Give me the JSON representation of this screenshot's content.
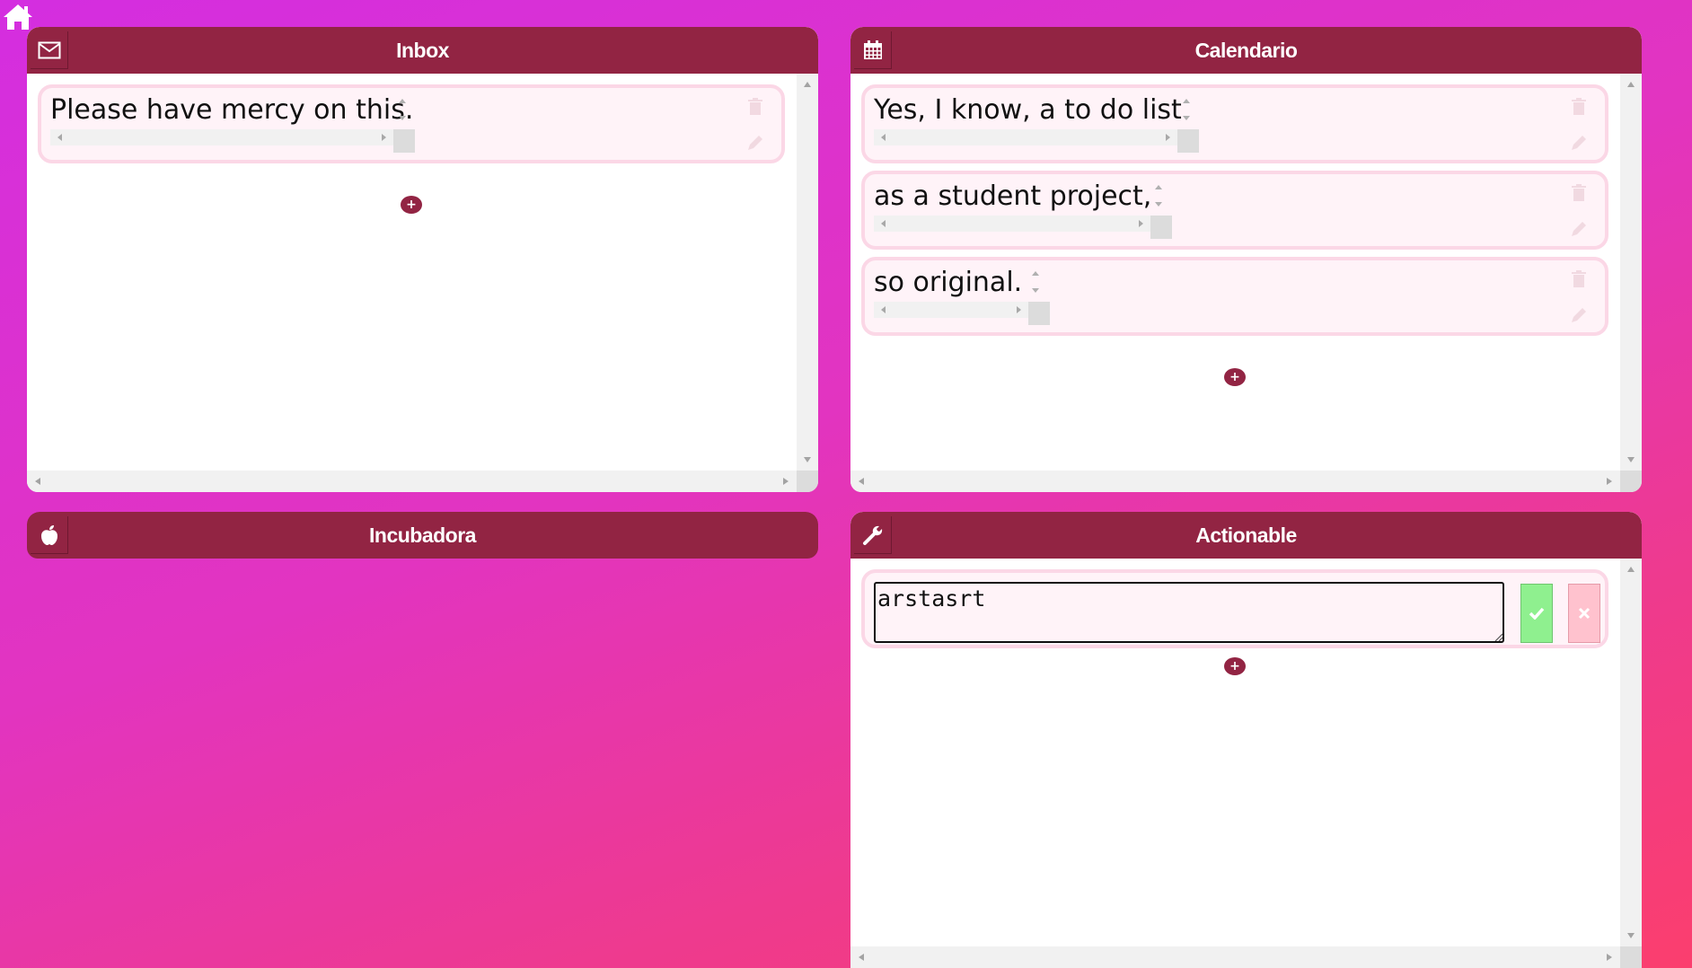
{
  "nav": {
    "home_icon": "home-icon"
  },
  "panels": {
    "inbox": {
      "title": "Inbox",
      "icon": "envelope-icon",
      "items": [
        "Please have mercy on this."
      ],
      "add_label": "+"
    },
    "calendario": {
      "title": "Calendario",
      "icon": "calendar-icon",
      "items": [
        "Yes, I know, a to do list",
        "as a student project,",
        "so original."
      ],
      "add_label": "+"
    },
    "incubadora": {
      "title": "Incubadora",
      "icon": "apple-icon"
    },
    "actionable": {
      "title": "Actionable",
      "icon": "wrench-icon",
      "editing_value": "arstasrt",
      "add_label": "+"
    }
  },
  "colors": {
    "header": "#922443",
    "card_bg": "#fff3f8",
    "card_border": "#fbd7e6",
    "confirm": "#8ff08f",
    "cancel": "#ffc2ce"
  }
}
